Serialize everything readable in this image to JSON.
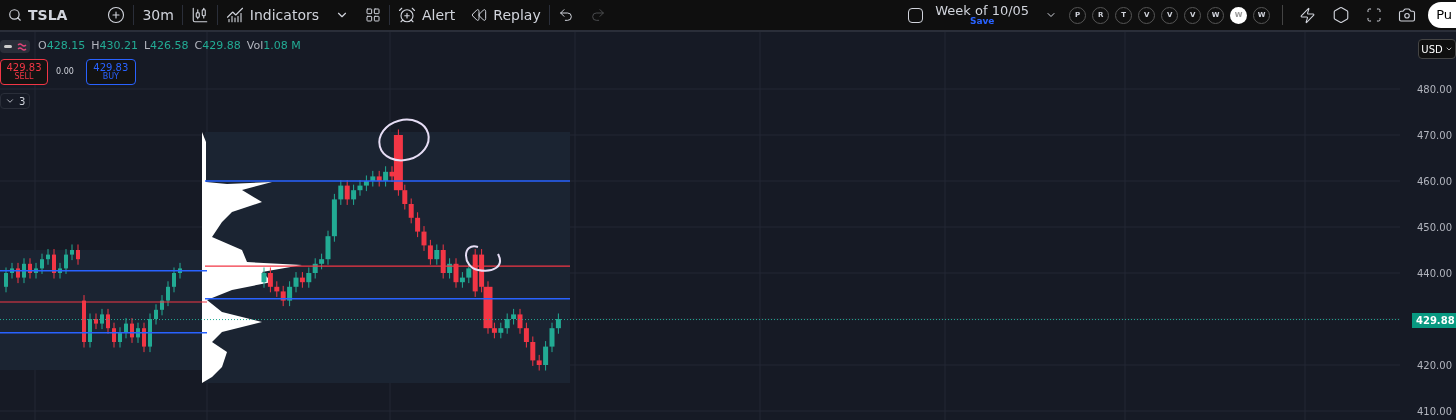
{
  "toolbar": {
    "symbol": "TSLA",
    "interval": "30m",
    "indicators_label": "Indicators",
    "alert_label": "Alert",
    "replay_label": "Replay",
    "undo": {
      "disabled": false
    },
    "redo": {
      "disabled": true
    }
  },
  "layout": {
    "title": "Week of 10/05",
    "subtitle": "Save",
    "checked": false
  },
  "quick_buttons": [
    {
      "label": "P",
      "selected": false
    },
    {
      "label": "R",
      "selected": false
    },
    {
      "label": "T",
      "selected": false
    },
    {
      "label": "V",
      "selected": false
    },
    {
      "label": "V",
      "selected": false
    },
    {
      "label": "V",
      "selected": false
    },
    {
      "label": "W",
      "selected": false
    },
    {
      "label": "W",
      "selected": true
    },
    {
      "label": "W",
      "selected": false
    }
  ],
  "publish_button": "Pu",
  "legend": [
    {
      "key": "O",
      "value": "428.15"
    },
    {
      "key": "H",
      "value": "430.21"
    },
    {
      "key": "L",
      "value": "426.58"
    },
    {
      "key": "C",
      "value": "429.88"
    },
    {
      "key": "Vol",
      "value": "1.08 M"
    }
  ],
  "trade": {
    "sell_price": "429.83",
    "sell_label": "SELL",
    "spread": "0.00",
    "buy_price": "429.83",
    "buy_label": "BUY"
  },
  "indicators_count": "3",
  "price_axis": {
    "currency": "USD",
    "labels": [
      "480.00",
      "470.00",
      "460.00",
      "450.00",
      "440.00",
      "420.00",
      "410.00"
    ],
    "last_price": "429.88"
  }
}
